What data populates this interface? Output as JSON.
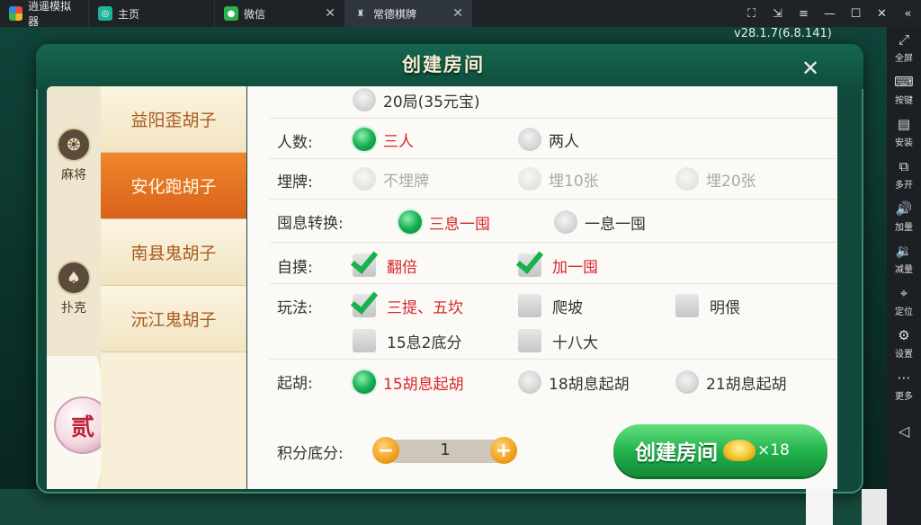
{
  "emulator": {
    "app_name": "逍遥模拟器",
    "tabs": [
      {
        "label": "主页"
      },
      {
        "label": "微信"
      },
      {
        "label": "常德棋牌"
      }
    ],
    "version": "v28.1.7(6.8.141)"
  },
  "sidebar": {
    "items": [
      {
        "label": "全屏",
        "icon": "fullscreen-icon"
      },
      {
        "label": "按键",
        "icon": "keyboard-icon"
      },
      {
        "label": "安装",
        "icon": "apk-icon"
      },
      {
        "label": "多开",
        "icon": "multi-instance-icon"
      },
      {
        "label": "加量",
        "icon": "volume-up-icon"
      },
      {
        "label": "减量",
        "icon": "volume-down-icon"
      },
      {
        "label": "定位",
        "icon": "location-icon"
      },
      {
        "label": "设置",
        "icon": "gear-icon"
      },
      {
        "label": "更多",
        "icon": "more-icon"
      }
    ]
  },
  "dialog": {
    "title": "创建房间",
    "categories": [
      {
        "label": "麻将",
        "icon": "mahjong-icon"
      },
      {
        "label": "扑克",
        "icon": "spade-icon"
      }
    ],
    "badge": "贰",
    "games": [
      {
        "label": "益阳歪胡子",
        "active": false
      },
      {
        "label": "安化跑胡子",
        "active": true
      },
      {
        "label": "南县鬼胡子",
        "active": false
      },
      {
        "label": "沅江鬼胡子",
        "active": false
      }
    ],
    "rounds_option": "20局(35元宝)",
    "rows": {
      "players": {
        "label": "人数:",
        "options": [
          "三人",
          "两人"
        ],
        "selected": "三人"
      },
      "burial": {
        "label": "埋牌:",
        "options": [
          "不埋牌",
          "埋10张",
          "埋20张"
        ],
        "disabled": true
      },
      "conversion": {
        "label": "囤息转换:",
        "options": [
          "三息一囤",
          "一息一囤"
        ],
        "selected": "三息一囤"
      },
      "self_draw": {
        "label": "自摸:",
        "options": [
          "翻倍",
          "加一囤"
        ],
        "checked": [
          "翻倍",
          "加一囤"
        ]
      },
      "rules": {
        "label": "玩法:",
        "options": [
          "三提、五坎",
          "爬坡",
          "明偎",
          "15息2底分",
          "十八大"
        ],
        "checked": [
          "三提、五坎"
        ]
      },
      "start_hu": {
        "label": "起胡:",
        "options": [
          "15胡息起胡",
          "18胡息起胡",
          "21胡息起胡"
        ],
        "selected": "15胡息起胡"
      }
    },
    "score": {
      "label": "积分底分:",
      "value": "1",
      "minus": "−",
      "plus": "+"
    },
    "create_button": {
      "label": "创建房间",
      "cost": "×18"
    },
    "close": "✕"
  }
}
